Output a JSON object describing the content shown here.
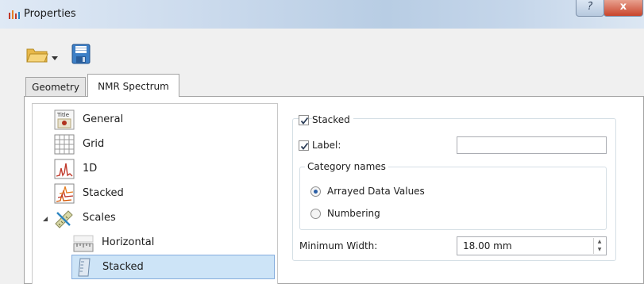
{
  "window": {
    "title": "Properties",
    "help_glyph": "?",
    "close_glyph": "x"
  },
  "toolbar": {
    "open_icon": "folder-open-icon",
    "dropdown_icon": "dropdown-arrow-icon",
    "save_icon": "floppy-save-icon"
  },
  "tabs": [
    {
      "label": "Geometry",
      "active": false
    },
    {
      "label": "NMR Spectrum",
      "active": true
    }
  ],
  "tree": {
    "items": [
      {
        "label": "General",
        "icon": "title-icon"
      },
      {
        "label": "Grid",
        "icon": "grid-icon"
      },
      {
        "label": "1D",
        "icon": "spectrum-1d-icon"
      },
      {
        "label": "Stacked",
        "icon": "stacked-spectra-icon"
      },
      {
        "label": "Scales",
        "icon": "scales-ruler-icon",
        "expanded": true
      },
      {
        "label": "Horizontal",
        "icon": "horizontal-scale-icon"
      },
      {
        "label": "Stacked",
        "icon": "vertical-scale-icon",
        "selected": true
      }
    ]
  },
  "panel": {
    "stacked_checkbox": {
      "label": "Stacked",
      "checked": true
    },
    "label_checkbox": {
      "label": "Label:",
      "checked": true
    },
    "label_value": "",
    "category_group_title": "Category names",
    "radio_options": [
      {
        "label": "Arrayed Data Values",
        "selected": true
      },
      {
        "label": "Numbering",
        "selected": false
      }
    ],
    "min_width_label": "Minimum Width:",
    "min_width_value": "18.00 mm"
  },
  "colors": {
    "selection_bg": "#cde4f7",
    "selection_border": "#84acdd",
    "titlebar": "#c9d9ec",
    "close_button": "#c9452c"
  }
}
